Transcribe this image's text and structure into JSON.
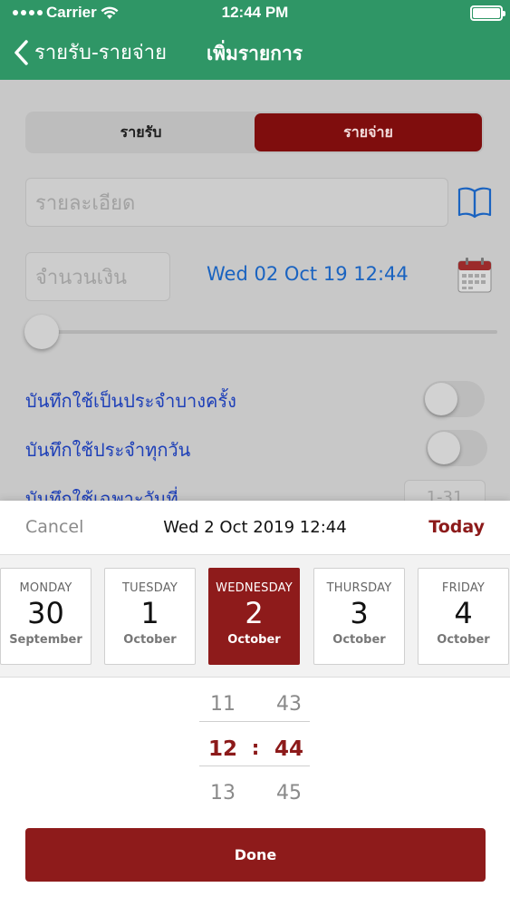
{
  "status_bar": {
    "carrier": "Carrier",
    "time": "12:44 PM"
  },
  "navbar": {
    "back_label": "รายรับ-รายจ่าย",
    "title": "เพิ่มรายการ"
  },
  "segment": {
    "income": "รายรับ",
    "expense": "รายจ่าย",
    "selected": "รายจ่าย"
  },
  "form": {
    "detail_placeholder": "รายละเอียด",
    "amount_placeholder": "จำนวนเงิน",
    "date_value": "Wed 02 Oct 19 12:44",
    "toggle_1_label": "บันทึกใช้เป็นประจำบางครั้ง",
    "toggle_2_label": "บันทึกใช้ประจำทุกวัน",
    "toggle_3_label": "บันทึกใช้เฉพาะวันที่",
    "range_value": "1-31"
  },
  "picker": {
    "cancel_label": "Cancel",
    "title": "Wed 2 Oct 2019 12:44",
    "today_label": "Today",
    "days": [
      {
        "dow": "MONDAY",
        "num": "30",
        "month": "September"
      },
      {
        "dow": "TUESDAY",
        "num": "1",
        "month": "October"
      },
      {
        "dow": "WEDNESDAY",
        "num": "2",
        "month": "October"
      },
      {
        "dow": "THURSDAY",
        "num": "3",
        "month": "October"
      },
      {
        "dow": "FRIDAY",
        "num": "4",
        "month": "October"
      }
    ],
    "selected_day_index": 2,
    "hours": [
      "11",
      "12",
      "13"
    ],
    "minutes": [
      "43",
      "44",
      "45"
    ],
    "separator": ":",
    "done_label": "Done"
  },
  "colors": {
    "navbar": "#2f9666",
    "accent_red": "#8e1b1b",
    "link_blue": "#1a63c0",
    "toggle_label_blue": "#1d3fb8"
  }
}
